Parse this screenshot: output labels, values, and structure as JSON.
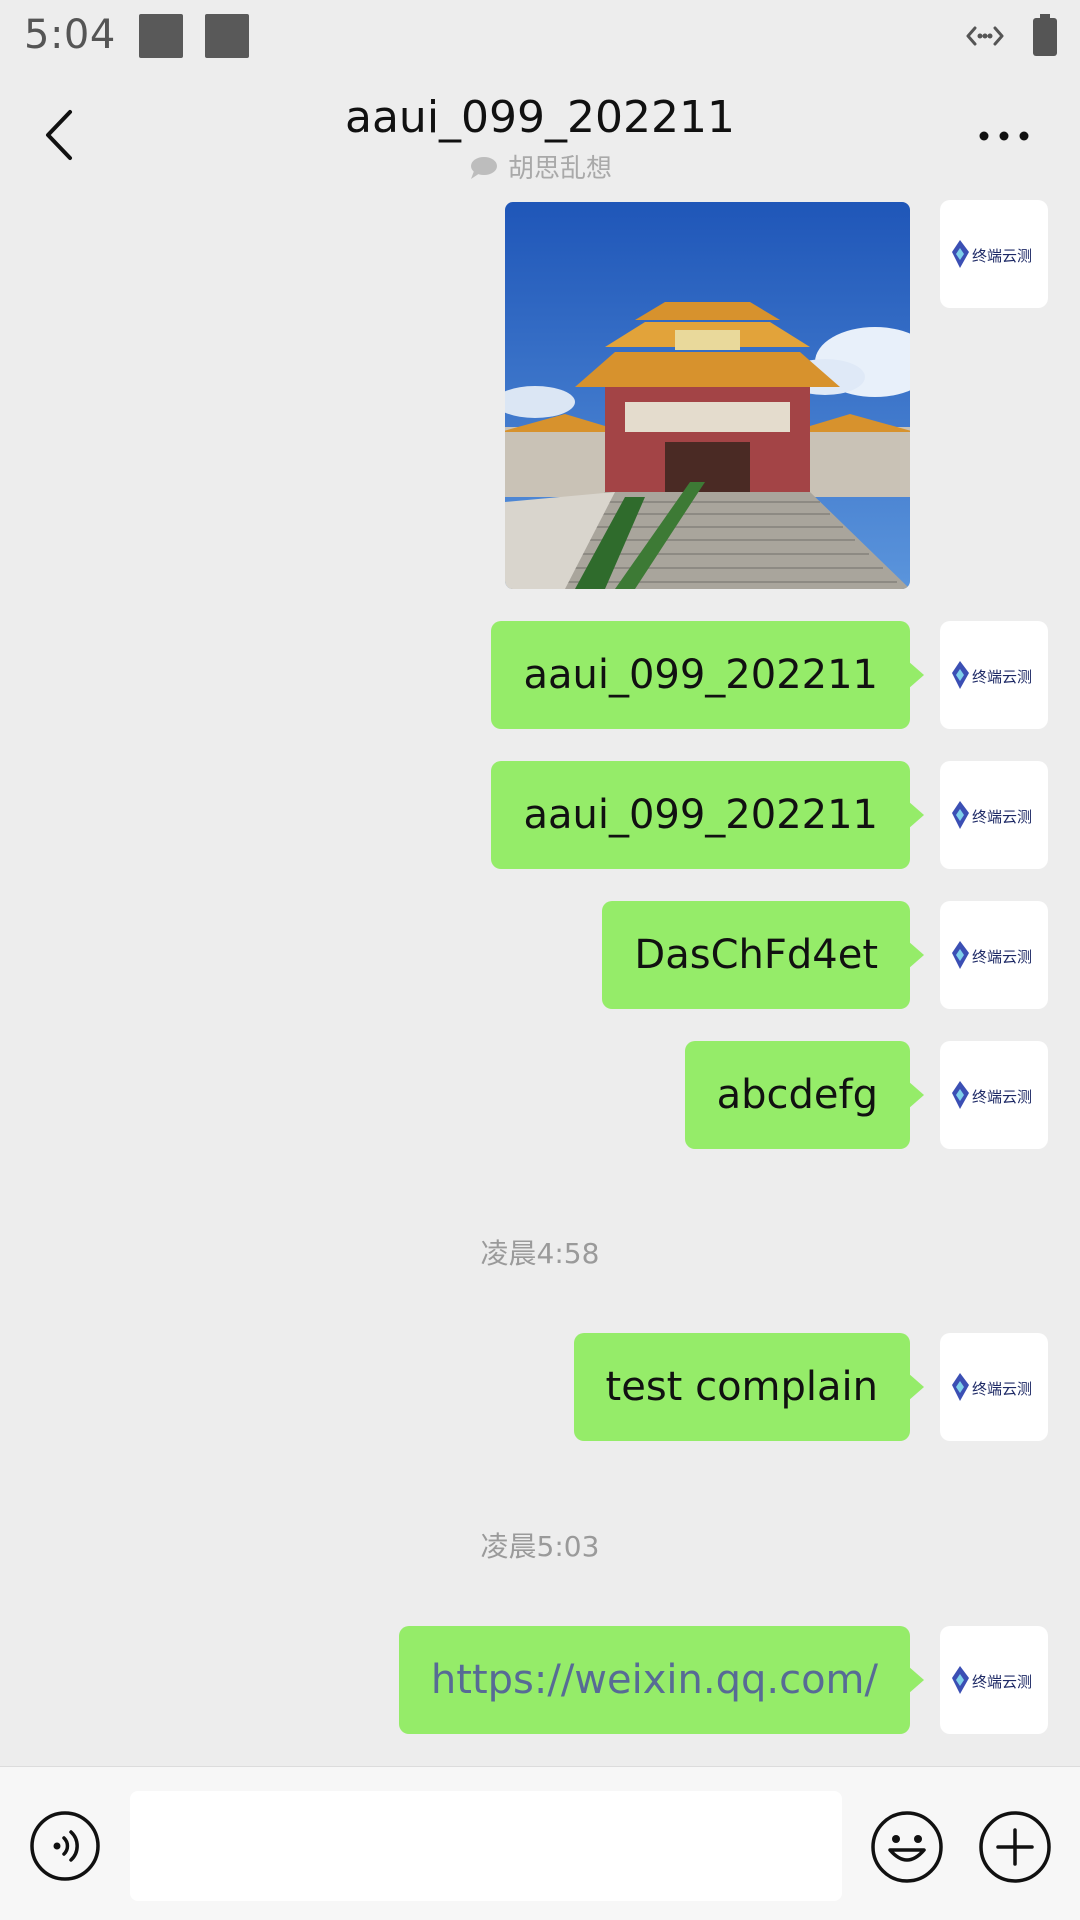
{
  "status_bar": {
    "time": "5:04"
  },
  "header": {
    "title": "aaui_099_202211",
    "subtitle": "胡思乱想"
  },
  "avatar": {
    "brand_text": "终端云测",
    "accent_color": "#3b4fb4"
  },
  "messages": [
    {
      "type": "image",
      "description": "temple photo"
    },
    {
      "type": "text",
      "text": "aaui_099_202211"
    },
    {
      "type": "text",
      "text": "aaui_099_202211"
    },
    {
      "type": "text",
      "text": "DasChFd4et"
    },
    {
      "type": "text",
      "text": "abcdefg"
    },
    {
      "type": "timestamp",
      "text": "凌晨4:58"
    },
    {
      "type": "text",
      "text": "test complain"
    },
    {
      "type": "timestamp",
      "text": "凌晨5:03"
    },
    {
      "type": "link",
      "text": "https://weixin.qq.com/"
    }
  ],
  "colors": {
    "bubble": "#95ec69",
    "background": "#ededed",
    "link": "#576b95"
  },
  "input": {
    "placeholder": "",
    "value": ""
  }
}
